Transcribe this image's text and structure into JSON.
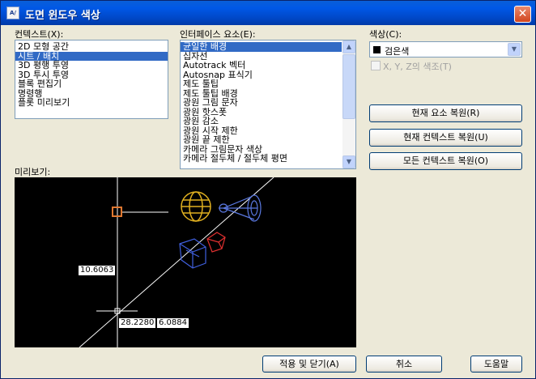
{
  "window": {
    "title": "도면 윈도우 색상",
    "close_glyph": "✕",
    "app_icon_text": "A/"
  },
  "context": {
    "label": "컨텍스트(X):",
    "items": [
      "2D 모형 공간",
      "시트 / 배치",
      "3D 평행 투영",
      "3D 투시 투영",
      "블록 편집기",
      "명령행",
      "플롯 미리보기"
    ],
    "selected": "시트 / 배치"
  },
  "interface": {
    "label": "인터페이스 요소(E):",
    "items": [
      "균일한 배경",
      "십자선",
      "Autotrack 벡터",
      "Autosnap 표식기",
      "제도 툴팁",
      "제도 툴팁 배경",
      "광원 그림 문자",
      "광원 핫스폿",
      "광원 감소",
      "광원 시작 제한",
      "광원 끝 제한",
      "카메라 그림문자 색상",
      "카메라 절두체 / 절두체 평면"
    ],
    "selected": "균일한 배경"
  },
  "color": {
    "label": "색상(C):",
    "value": "검은색",
    "swatch": "#000000",
    "xyz_label": "X, Y, Z의 색조(T)",
    "xyz_checked": false
  },
  "buttons": {
    "restore_element": "현재 요소 복원(R)",
    "restore_context": "현재 컨텍스트 복원(U)",
    "restore_all": "모든 컨텍스트 복원(O)",
    "apply_close": "적용 및 닫기(A)",
    "cancel": "취소",
    "help": "도움말"
  },
  "preview": {
    "label": "미리보기:",
    "background": "#000000",
    "dim_vertical": "10.6063",
    "coord_x": "28.2280",
    "coord_y": "6.0884"
  }
}
